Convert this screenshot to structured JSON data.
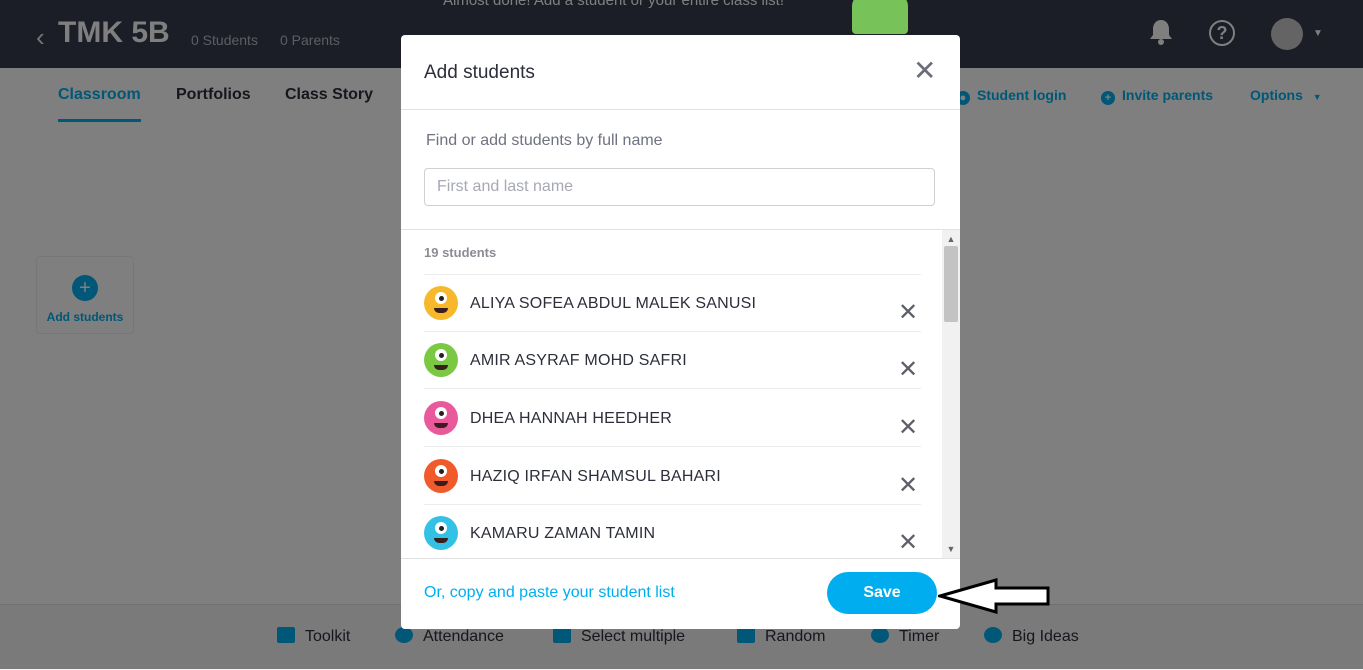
{
  "header": {
    "back_glyph": "‹",
    "class_name": "TMK 5B",
    "students_count": "0 Students",
    "parents_count": "0 Parents",
    "onboarding_text": "Almost done! Add a student or your entire class list!"
  },
  "nav": {
    "tabs": [
      {
        "label": "Classroom",
        "active": true
      },
      {
        "label": "Portfolios",
        "active": false
      },
      {
        "label": "Class Story",
        "active": false
      }
    ],
    "student_login": "Student login",
    "invite_parents": "Invite parents",
    "options": "Options"
  },
  "main": {
    "add_students_card": "Add students"
  },
  "toolbar": {
    "items": [
      "Toolkit",
      "Attendance",
      "Select multiple",
      "Random",
      "Timer",
      "Big Ideas"
    ]
  },
  "modal": {
    "title": "Add students",
    "find_label": "Find or add students by full name",
    "input_placeholder": "First and last name",
    "input_value": "",
    "student_count": "19 students",
    "students": [
      {
        "name": "ALIYA SOFEA ABDUL MALEK SANUSI",
        "avatar_color": "#f7b92b"
      },
      {
        "name": "AMIR ASYRAF MOHD SAFRI",
        "avatar_color": "#7bc843"
      },
      {
        "name": "DHEA HANNAH HEEDHER",
        "avatar_color": "#e85a9c"
      },
      {
        "name": "HAZIQ IRFAN SHAMSUL BAHARI",
        "avatar_color": "#f15a2b"
      },
      {
        "name": "KAMARU ZAMAN TAMIN",
        "avatar_color": "#33c2e6"
      }
    ],
    "copy_paste_link": "Or, copy and paste your student list",
    "save_label": "Save"
  },
  "colors": {
    "accent": "#00aeef",
    "header_bg": "#363a4e"
  }
}
